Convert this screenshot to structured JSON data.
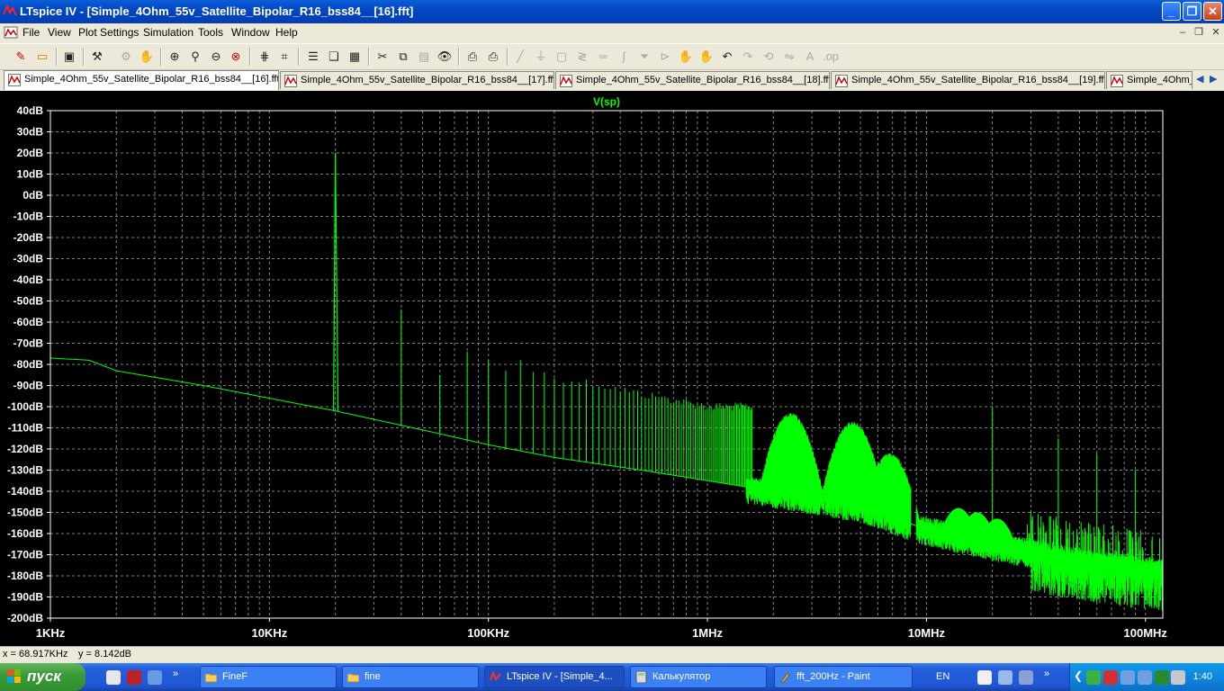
{
  "window": {
    "title": "LTspice IV - [Simple_4Ohm_55v_Satellite_Bipolar_R16_bss84__[16].fft]"
  },
  "menu": [
    "File",
    "View",
    "Plot Settings",
    "Simulation",
    "Tools",
    "Window",
    "Help"
  ],
  "tabs": [
    "Simple_4Ohm_55v_Satellite_Bipolar_R16_bss84__[16].fft",
    "Simple_4Ohm_55v_Satellite_Bipolar_R16_bss84__[17].fft",
    "Simple_4Ohm_55v_Satellite_Bipolar_R16_bss84__[18].fft",
    "Simple_4Ohm_55v_Satellite_Bipolar_R16_bss84__[19].fft",
    "Simple_4Ohm_"
  ],
  "chart_data": {
    "type": "line",
    "title": "V(sp)",
    "x_scale": "log",
    "xlim": [
      1000,
      120000000
    ],
    "ylim": [
      -200,
      40
    ],
    "x_ticks": [
      {
        "value": 1000,
        "label": "1KHz"
      },
      {
        "value": 10000,
        "label": "10KHz"
      },
      {
        "value": 100000,
        "label": "100KHz"
      },
      {
        "value": 1000000,
        "label": "1MHz"
      },
      {
        "value": 10000000,
        "label": "10MHz"
      },
      {
        "value": 100000000,
        "label": "100MHz"
      }
    ],
    "y_ticks": [
      "40dB",
      "30dB",
      "20dB",
      "10dB",
      "0dB",
      "-10dB",
      "-20dB",
      "-30dB",
      "-40dB",
      "-50dB",
      "-60dB",
      "-70dB",
      "-80dB",
      "-90dB",
      "-100dB",
      "-110dB",
      "-120dB",
      "-130dB",
      "-140dB",
      "-150dB",
      "-160dB",
      "-170dB",
      "-180dB",
      "-190dB",
      "-200dB"
    ],
    "y_tick_values": [
      40,
      30,
      20,
      10,
      0,
      -10,
      -20,
      -30,
      -40,
      -50,
      -60,
      -70,
      -80,
      -90,
      -100,
      -110,
      -120,
      -130,
      -140,
      -150,
      -160,
      -170,
      -180,
      -190,
      -200
    ],
    "grid": true,
    "series": [
      {
        "name": "V(sp)",
        "color": "#00ff00",
        "noise_floor": [
          [
            1000,
            -77
          ],
          [
            1500,
            -78
          ],
          [
            2000,
            -83
          ],
          [
            5000,
            -90
          ],
          [
            10000,
            -96
          ],
          [
            20000,
            -102
          ],
          [
            50000,
            -111
          ],
          [
            100000,
            -118
          ],
          [
            200000,
            -124
          ],
          [
            500000,
            -130
          ],
          [
            1000000,
            -135
          ],
          [
            2000000,
            -140
          ],
          [
            5000000,
            -147
          ],
          [
            10000000,
            -158
          ],
          [
            20000000,
            -165
          ],
          [
            50000000,
            -173
          ],
          [
            120000000,
            -178
          ]
        ],
        "peaks": [
          [
            20000,
            20
          ],
          [
            40000,
            -54
          ],
          [
            60000,
            -85
          ],
          [
            80000,
            -74
          ],
          [
            100000,
            -78
          ],
          [
            120000,
            -83
          ],
          [
            140000,
            -78
          ],
          [
            160000,
            -81
          ],
          [
            200000,
            -84
          ],
          [
            300000,
            -87
          ],
          [
            500000,
            -92
          ],
          [
            1000000,
            -98
          ]
        ],
        "humps": [
          [
            2400000,
            -103
          ],
          [
            4600000,
            -107
          ],
          [
            6800000,
            -122
          ],
          [
            14000000,
            -148
          ],
          [
            17000000,
            -150
          ],
          [
            21000000,
            -153
          ]
        ],
        "spurs": [
          [
            20000000,
            -100
          ],
          [
            40000000,
            -115
          ],
          [
            60000000,
            -122
          ],
          [
            90000000,
            -130
          ]
        ]
      }
    ]
  },
  "status": {
    "x": "x = 68.917KHz",
    "y": "y = 8.142dB"
  },
  "taskbar": {
    "start": "пуск",
    "tasks": [
      "FineF",
      "fine",
      "LTspice IV - [Simple_4...",
      "Калькулятор",
      "fft_200Hz - Paint"
    ],
    "lang": "EN",
    "clock": "1:40"
  }
}
